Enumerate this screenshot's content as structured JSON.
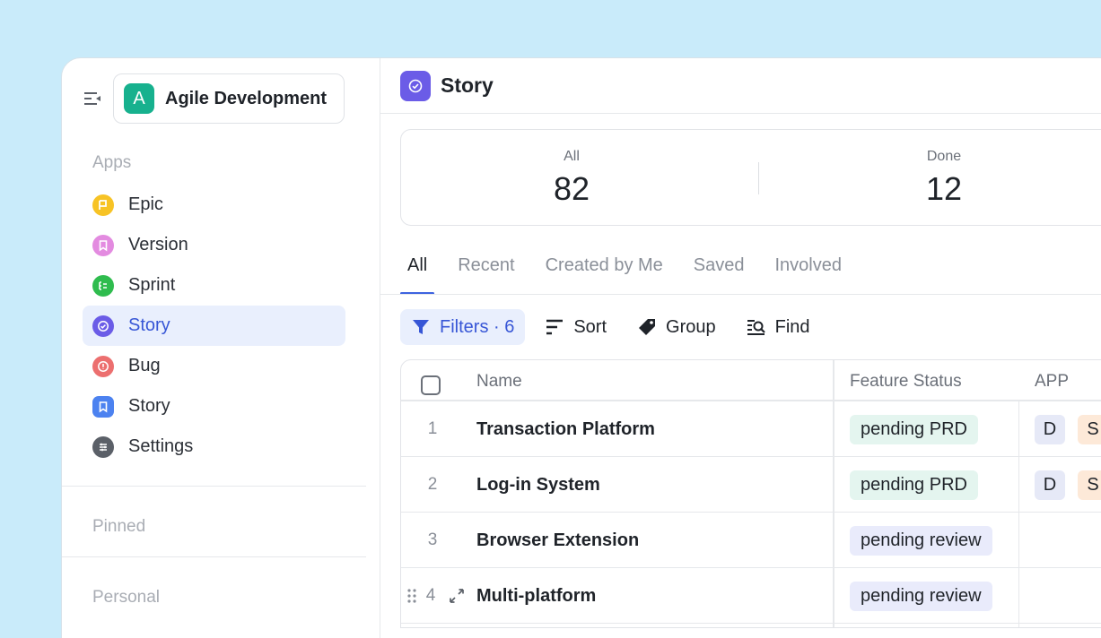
{
  "workspace": {
    "avatar_letter": "A",
    "name": "Agile Development"
  },
  "sidebar": {
    "apps_label": "Apps",
    "items": [
      {
        "label": "Epic",
        "icon": "flag-icon",
        "color": "#f7c325"
      },
      {
        "label": "Version",
        "icon": "bookmark-icon",
        "color": "#e38be0"
      },
      {
        "label": "Sprint",
        "icon": "list-icon",
        "color": "#2fbc4e"
      },
      {
        "label": "Story",
        "icon": "check-circle-icon",
        "color": "#6b5ce7",
        "active": true
      },
      {
        "label": "Bug",
        "icon": "alert-icon",
        "color": "#ec6f6f"
      },
      {
        "label": "Story",
        "icon": "bookmark-icon",
        "color": "#4c82f0"
      },
      {
        "label": "Settings",
        "icon": "sliders-icon",
        "color": "#5b6068"
      }
    ],
    "pinned_label": "Pinned",
    "personal_label": "Personal"
  },
  "header": {
    "title": "Story"
  },
  "stats": [
    {
      "label": "All",
      "value": "82"
    },
    {
      "label": "Done",
      "value": "12"
    }
  ],
  "tabs": [
    "All",
    "Recent",
    "Created by Me",
    "Saved",
    "Involved"
  ],
  "toolbar": {
    "filters_label": "Filters · 6",
    "sort_label": "Sort",
    "group_label": "Group",
    "find_label": "Find"
  },
  "table": {
    "columns": {
      "name": "Name",
      "feature_status": "Feature Status",
      "app": "APP"
    },
    "rows": [
      {
        "index": "1",
        "name": "Transaction Platform",
        "status": "pending PRD",
        "app_tags": [
          "D",
          "S"
        ]
      },
      {
        "index": "2",
        "name": "Log-in System",
        "status": "pending PRD",
        "app_tags": [
          "D",
          "S"
        ]
      },
      {
        "index": "3",
        "name": "Browser Extension",
        "status": "pending review",
        "app_tags": []
      },
      {
        "index": "4",
        "name": "Multi-platform",
        "status": "pending review",
        "app_tags": []
      }
    ]
  },
  "colors": {
    "background": "#c9ebfa",
    "accent": "#3e63e0",
    "active_nav_bg": "#e9effd",
    "status_prd_bg": "#e4f5ef",
    "status_review_bg": "#e9ebfb",
    "tag_d_bg": "#e6e9f7",
    "tag_s_bg": "#fde9d8"
  }
}
